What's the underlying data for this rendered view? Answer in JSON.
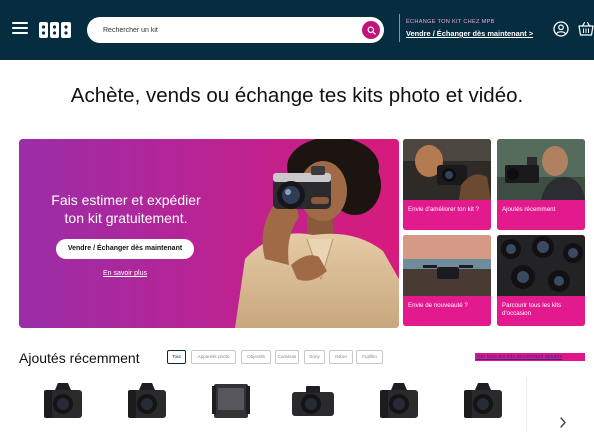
{
  "header": {
    "search": {
      "placeholder": "Rechercher un kit",
      "value": ""
    },
    "promo_label": "ÉCHANGE TON KIT CHEZ MPB",
    "promo_link": "Vendre / Échanger dès maintenant >",
    "colors": {
      "background": "#052c3f",
      "accent": "#c2117a",
      "promo_label": "#f4a9d4"
    },
    "icons": [
      "menu-icon",
      "mpb-logo-icon",
      "search-icon",
      "user-icon",
      "basket-icon"
    ]
  },
  "headline": "Achète, vends ou échange tes kits photo et vidéo.",
  "hero": {
    "text": "Fais estimer et expédier ton kit gratuitement.",
    "button_label": "Vendre / Échanger dès maintenant",
    "more_link": "En savoir plus",
    "colors": {
      "gradient_start": "#9a2ea8",
      "gradient_end": "#d81a7c"
    }
  },
  "tiles": [
    {
      "label": "Envie d'améliorer ton kit ?"
    },
    {
      "label": "Ajoutés récemment"
    },
    {
      "label": "Envie de nouveauté ?"
    },
    {
      "label": "Parcourir tous les kits d'occasion"
    }
  ],
  "recent": {
    "title": "Ajoutés récemment",
    "filters": [
      {
        "label": "Tout",
        "active": true
      },
      {
        "label": "Appareils photo",
        "active": false
      },
      {
        "label": "Objectifs",
        "active": false
      },
      {
        "label": "Caméras",
        "active": false
      },
      {
        "label": "Sony",
        "active": false
      },
      {
        "label": "Nikon",
        "active": false
      },
      {
        "label": "Fujifilm",
        "active": false
      }
    ],
    "see_all": "Voir tous les kits récemment ajoutés",
    "products": [
      {
        "icon": "dslr-camera-icon"
      },
      {
        "icon": "dslr-camera-icon"
      },
      {
        "icon": "cinema-camera-icon"
      },
      {
        "icon": "mirrorless-camera-icon"
      },
      {
        "icon": "dslr-camera-icon"
      },
      {
        "icon": "dslr-camera-icon"
      }
    ],
    "colors": {
      "see_all_highlight": "#e0178a"
    }
  }
}
